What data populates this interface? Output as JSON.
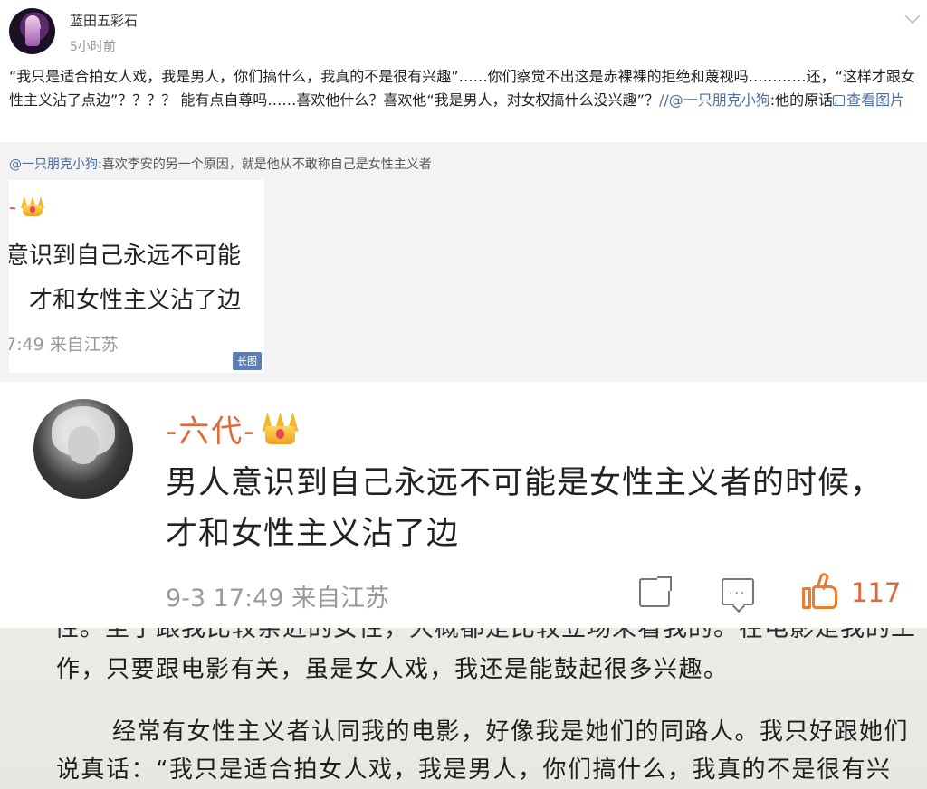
{
  "post": {
    "username": "蓝田五彩石",
    "time": "5小时前",
    "text_part1": "“我只是适合拍女人戏，我是男人，你们搞什么，我真的不是很有兴趣”……你们察觉不出这是赤裸裸的拒绝和蔑视吗…………还，“这样才跟女性主义沾了点边”？？？？ 能有点自尊吗……喜欢他什么？喜欢他“我是男人，对女权搞什么没兴趣”？",
    "mention": "//@一只朋克小狗",
    "text_part2": ":他的原话",
    "view_image": "查看图片"
  },
  "repost": {
    "mention": "@一只朋克小狗",
    "text": ":喜欢李安的另一个原因，就是他从不敢称自己是女性主义者",
    "long_image": {
      "name": "-",
      "line1": "意识到自己永远不可能",
      "line2": "才和女性主义沾了边",
      "meta": "7:49  来自江苏",
      "badge": "长图"
    }
  },
  "comment": {
    "name": "-六代-",
    "text": "男人意识到自己永远不可能是女性主义者的时候，才和女性主义沾了边",
    "meta": "9-3 17:49  来自江苏",
    "like_count": "117"
  },
  "book": {
    "cut_line": "性。至于跟我比较亲近的女性，大概都是比较立场来看我的。在电影是我的工",
    "line1": "作，只要跟电影有关，虽是女人戏，我还是能鼓起很多兴趣。",
    "line2": "经常有女性主义者认同我的电影，好像我是她们的同路人。我只好跟她们",
    "line3": "说真话：“我只是适合拍女人戏，我是男人，你们搞什么，我真的不是很有兴"
  }
}
